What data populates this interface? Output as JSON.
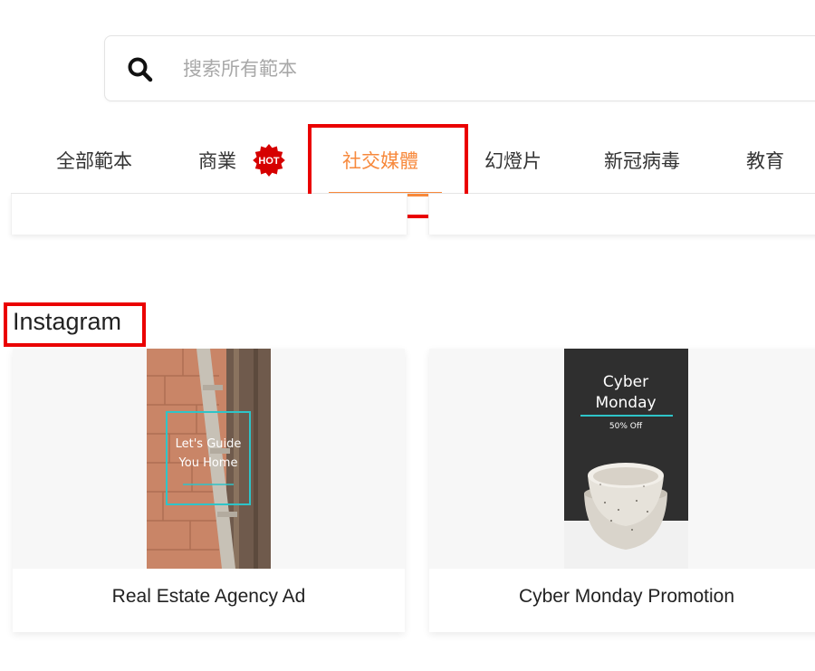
{
  "search": {
    "placeholder": "搜索所有範本",
    "value": ""
  },
  "tabs": [
    {
      "label": "全部範本",
      "active": false
    },
    {
      "label": "商業",
      "active": false,
      "badge": "HOT"
    },
    {
      "label": "社交媒體",
      "active": true
    },
    {
      "label": "幻燈片",
      "active": false
    },
    {
      "label": "新冠病毒",
      "active": false
    },
    {
      "label": "教育",
      "active": false
    }
  ],
  "section": {
    "title": "Instagram"
  },
  "cards": [
    {
      "title": "Real Estate Agency Ad",
      "thumb_text": [
        "Let's Guide",
        "You Home"
      ]
    },
    {
      "title": "Cyber Monday Promotion",
      "thumb_text": [
        "Cyber",
        "Monday",
        "50% Off"
      ]
    }
  ],
  "colors": {
    "accent": "#f7893c",
    "highlight_box": "#ea0000",
    "badge": "#d60000",
    "thumb_teal": "#2ec4c8"
  }
}
